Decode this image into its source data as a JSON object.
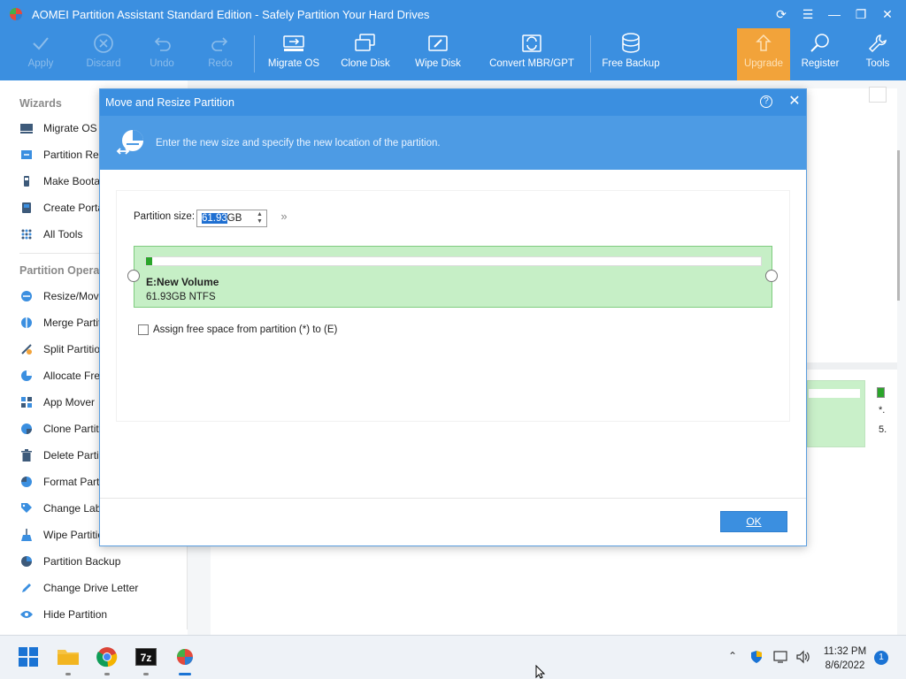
{
  "window": {
    "title": "AOMEI Partition Assistant Standard Edition - Safely Partition Your Hard Drives",
    "controls": [
      "refresh-icon",
      "menu-icon",
      "minimize-icon",
      "restore-icon",
      "close-icon"
    ]
  },
  "toolbar": {
    "apply": "Apply",
    "discard": "Discard",
    "undo": "Undo",
    "redo": "Redo",
    "migrate_os": "Migrate OS",
    "clone_disk": "Clone Disk",
    "wipe_disk": "Wipe Disk",
    "convert": "Convert MBR/GPT",
    "free_backup": "Free Backup",
    "upgrade": "Upgrade",
    "register": "Register",
    "tools": "Tools"
  },
  "sidebar": {
    "wizards_title": "Wizards",
    "wizards": [
      {
        "label": "Migrate OS to",
        "icon": "migrate-os-icon"
      },
      {
        "label": "Partition Reco",
        "icon": "partition-recovery-icon"
      },
      {
        "label": "Make Bootab",
        "icon": "bootable-media-icon"
      },
      {
        "label": "Create Porta",
        "icon": "portable-windows-icon"
      },
      {
        "label": "All Tools",
        "icon": "all-tools-icon"
      }
    ],
    "operations_title": "Partition Operat",
    "operations": [
      {
        "label": "Resize/Move",
        "icon": "resize-move-icon"
      },
      {
        "label": "Merge Partiti",
        "icon": "merge-partition-icon"
      },
      {
        "label": "Split Partition",
        "icon": "split-partition-icon"
      },
      {
        "label": "Allocate Free",
        "icon": "allocate-free-space-icon"
      },
      {
        "label": "App Mover",
        "icon": "app-mover-icon"
      },
      {
        "label": "Clone Partitio",
        "icon": "clone-partition-icon"
      },
      {
        "label": "Delete Partiti",
        "icon": "delete-partition-icon"
      },
      {
        "label": "Format Partit",
        "icon": "format-partition-icon"
      },
      {
        "label": "Change Labe",
        "icon": "change-label-icon"
      },
      {
        "label": "Wipe Partition",
        "icon": "wipe-partition-icon"
      },
      {
        "label": "Partition Backup",
        "icon": "partition-backup-icon"
      },
      {
        "label": "Change Drive Letter",
        "icon": "change-drive-letter-icon"
      },
      {
        "label": "Hide Partition",
        "icon": "hide-partition-icon"
      }
    ]
  },
  "background_disk": {
    "line1": "*.",
    "line2": "5."
  },
  "dialog": {
    "title": "Move and Resize Partition",
    "banner_text": "Enter the new size and specify the new location of the partition.",
    "size_label": "Partition size:",
    "size_value_selected": "61.93",
    "size_unit": "GB",
    "partition_name": "E:New Volume",
    "partition_info": "61.93GB NTFS",
    "partition_used_fraction": 0.01,
    "assign_label": "Assign free space from partition (*) to (E)",
    "assign_checked": false,
    "ok_label": "OK"
  },
  "taskbar": {
    "apps": [
      "start-icon",
      "file-explorer-icon",
      "chrome-icon",
      "7zip-icon",
      "aomei-icon"
    ],
    "time": "11:32 PM",
    "date": "8/6/2022",
    "notifications": "1"
  },
  "colors": {
    "brand_blue": "#3b8fe0",
    "upgrade_orange": "#f2a33a",
    "partition_green": "#c6efc6"
  }
}
